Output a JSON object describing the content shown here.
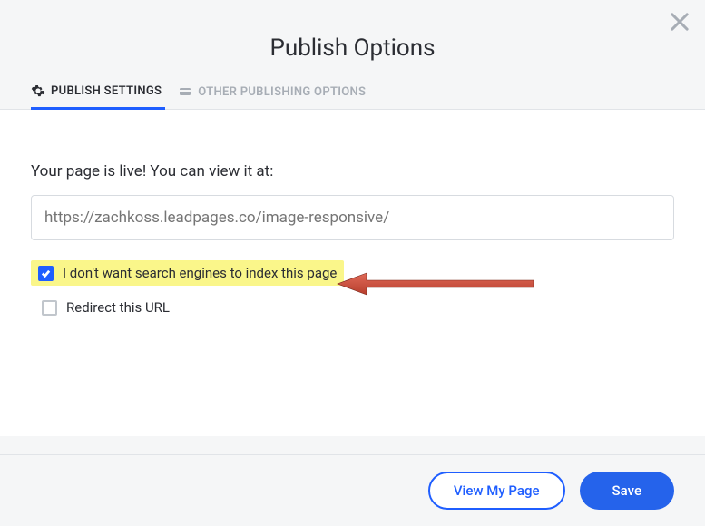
{
  "title": "Publish Options",
  "close_icon": "close",
  "tabs": {
    "settings": {
      "label": "PUBLISH SETTINGS",
      "active": true
    },
    "other": {
      "label": "OTHER PUBLISHING OPTIONS",
      "active": false
    }
  },
  "content": {
    "live_text": "Your page is live! You can view it at:",
    "url_placeholder": "https://zachkoss.leadpages.co/image-responsive/",
    "url_value": "",
    "checkboxes": {
      "noindex": {
        "label": "I don't want search engines to index this page",
        "checked": true,
        "highlighted": true
      },
      "redirect": {
        "label": "Redirect this URL",
        "checked": false
      }
    }
  },
  "footer": {
    "view_label": "View My Page",
    "save_label": "Save"
  },
  "colors": {
    "accent": "#1f5eff",
    "primary_btn": "#2563eb",
    "highlight": "#faf68a",
    "arrow": "#cd4f3e"
  }
}
